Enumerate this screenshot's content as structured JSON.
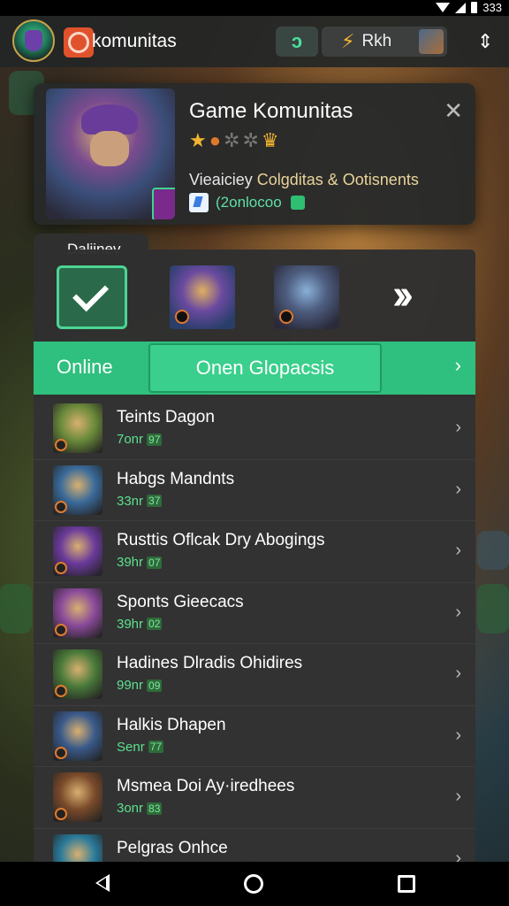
{
  "status_bar": {
    "time": "333"
  },
  "app_bar": {
    "title": "komunitas",
    "points_label": "Rkh"
  },
  "game_card": {
    "title": "Game Komunitas",
    "subtitle_prefix": "Vieaiciey",
    "subtitle": "Colgditas & Ootisnents",
    "meta_text": "(2onlocoo"
  },
  "daily": {
    "tab_label": "Daliinev"
  },
  "status_row": {
    "online_label": "Online",
    "group_label": "Onen Glopacsis"
  },
  "list": [
    {
      "name": "Teints Dagon",
      "time": "7onr",
      "badge": "97",
      "hue": "#6a8a3a"
    },
    {
      "name": "Habgs Mandnts",
      "time": "33nr",
      "badge": "37",
      "hue": "#3a6a9a"
    },
    {
      "name": "Rusttis Oflcak Dry Abogings",
      "time": "39hr",
      "badge": "07",
      "hue": "#6a3a9a"
    },
    {
      "name": "Sponts Gieecacs",
      "time": "39hr",
      "badge": "02",
      "hue": "#8a4a9a"
    },
    {
      "name": "Hadines Dlradis Ohidires",
      "time": "99nr",
      "badge": "09",
      "hue": "#4a7a3a"
    },
    {
      "name": "Halkis Dhapen",
      "time": "Senr",
      "badge": "77",
      "hue": "#3a5a8a"
    },
    {
      "name": "Msmea Doi Ay·iredhees",
      "time": "3onr",
      "badge": "83",
      "hue": "#7a4a2a"
    },
    {
      "name": "Pelgras Onhce",
      "time": "",
      "badge": "",
      "hue": "#2a7a9a"
    }
  ]
}
